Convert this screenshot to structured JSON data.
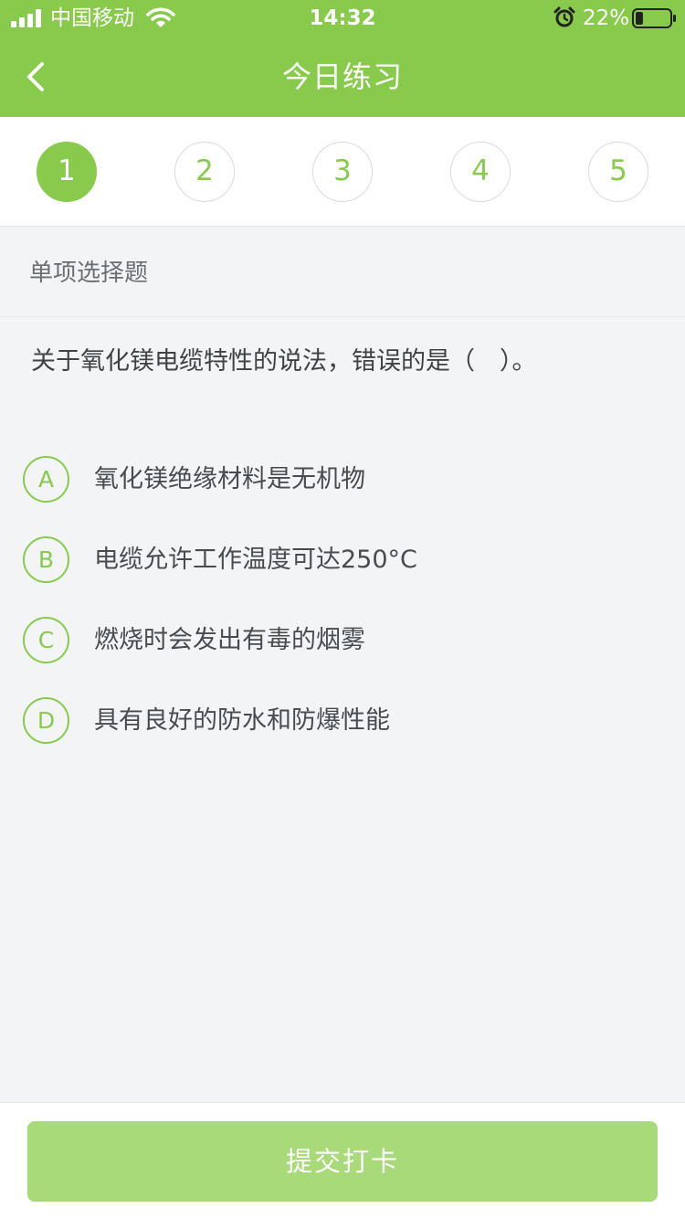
{
  "status_bar": {
    "carrier": "中国移动",
    "time": "14:32",
    "battery_percent": "22%",
    "battery_level": 0.22,
    "icons": [
      "signal-icon",
      "wifi-icon",
      "alarm-icon",
      "battery-icon"
    ]
  },
  "nav": {
    "title": "今日练习",
    "back_icon": "chevron-left-icon"
  },
  "steps": [
    {
      "label": "1",
      "active": true
    },
    {
      "label": "2",
      "active": false
    },
    {
      "label": "3",
      "active": false
    },
    {
      "label": "4",
      "active": false
    },
    {
      "label": "5",
      "active": false
    }
  ],
  "question": {
    "type": "单项选择题",
    "text": "关于氧化镁电缆特性的说法，错误的是（　）。",
    "options": [
      {
        "letter": "A",
        "text": "氧化镁绝缘材料是无机物"
      },
      {
        "letter": "B",
        "text": "电缆允许工作温度可达250°C"
      },
      {
        "letter": "C",
        "text": "燃烧时会发出有毒的烟雾"
      },
      {
        "letter": "D",
        "text": "具有良好的防水和防爆性能"
      }
    ]
  },
  "footer": {
    "submit_label": "提交打卡"
  },
  "colors": {
    "brand_green": "#88cb4c",
    "button_disabled": "#a8da7a",
    "background": "#f2f4f6"
  }
}
